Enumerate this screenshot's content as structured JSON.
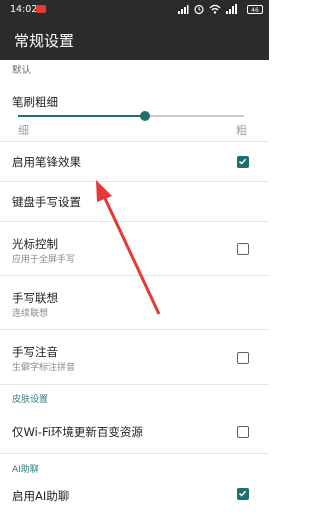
{
  "status_bar": {
    "time": "14:02",
    "rec_badge": "ɾɐ",
    "battery": "46"
  },
  "app_bar": {
    "title": "常规设置"
  },
  "settings": {
    "default_label": "默认",
    "brush_width": {
      "label": "笔刷粗细",
      "min_label": "细",
      "max_label": "粗",
      "level": 0.56
    },
    "stroke_effect": {
      "label": "启用笔锋效果",
      "checked": true
    },
    "keyboard_handwriting": {
      "label": "键盘手写设置"
    },
    "cursor_control": {
      "label": "光标控制",
      "sub": "应用于全屏手写",
      "checked": false
    },
    "handwriting_assoc": {
      "label": "手写联想",
      "sub": "连续联想"
    },
    "handwriting_pinyin": {
      "label": "手写注音",
      "sub": "生僻字标注拼音",
      "checked": false
    },
    "skin_section": "皮肤设置",
    "wifi_update": {
      "label": "仅Wi-Fi环境更新百变资源",
      "checked": false
    },
    "ai_section": "AI助聊",
    "enable_ai": {
      "label": "启用AI助聊",
      "checked": true
    }
  },
  "colors": {
    "accent": "#1e6f6f",
    "bar": "#2b2b2b",
    "arrow": "#e53935"
  },
  "icons": {
    "check": "check-icon",
    "arrow": "red-annotation-arrow"
  }
}
